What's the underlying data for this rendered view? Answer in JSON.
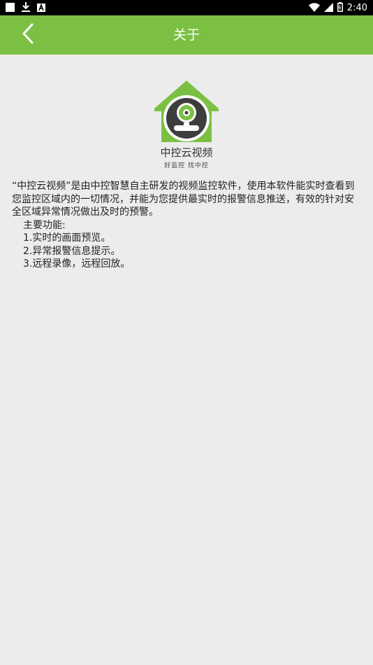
{
  "statusbar": {
    "time": "2:40",
    "icons": [
      "notification-square-icon",
      "download-icon",
      "app-a-icon",
      "wifi-icon",
      "signal-icon",
      "battery-icon"
    ]
  },
  "appbar": {
    "title": "关于",
    "background": "#7bc043"
  },
  "about": {
    "app_name": "中控云视频",
    "slogan": "好监控 找中控",
    "description": "“中控云视频”是由中控智慧自主研发的视频监控软件，使用本软件能实时查看到您监控区域内的一切情况，并能为您提供最实时的报警信息推送，有效的针对安全区域异常情况做出及时的预警。",
    "features_title": "主要功能:",
    "features": [
      "1.实时的画面预览。",
      "2.异常报警信息提示。",
      "3.远程录像，远程回放。"
    ]
  }
}
